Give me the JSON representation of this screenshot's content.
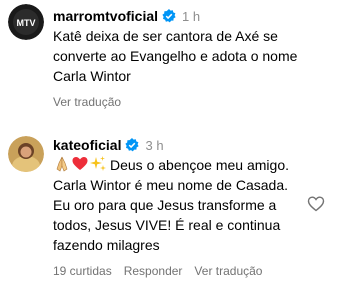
{
  "comments": [
    {
      "username": "marromtvoficial",
      "time": "1 h",
      "text": "Katê deixa de ser cantora de Axé se converte ao Evangelho e adota o nome Carla Wintor",
      "translate": "Ver tradução",
      "avatar_icon": "mtv-logo-avatar"
    },
    {
      "username": "kateoficial",
      "time": "3 h",
      "emojis": [
        "praying-hands-emoji",
        "red-heart-emoji",
        "sparkles-emoji"
      ],
      "text": "Deus o abençoe meu amigo. Carla Wintor é meu nome de Casada. Eu oro para que Jesus transforme a todos, Jesus VIVE! É real e continua fazendo milagres",
      "likes": "19 curtidas",
      "reply": "Responder",
      "translate": "Ver tradução",
      "avatar_icon": "profile-photo-avatar"
    }
  ],
  "colors": {
    "verified": "#0095f6",
    "muted": "#737373",
    "heart_red": "#ed2e3a"
  }
}
